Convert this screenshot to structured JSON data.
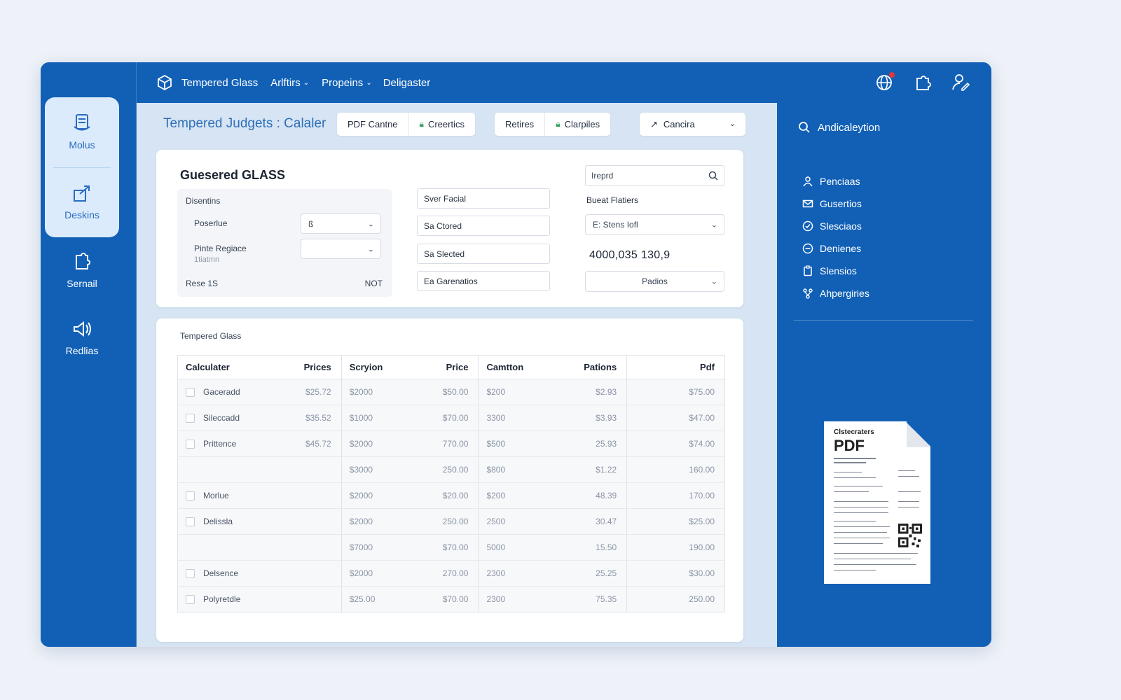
{
  "rail": {
    "items": [
      {
        "label": "Molus",
        "icon": "document-list-icon"
      },
      {
        "label": "Deskins",
        "icon": "export-icon"
      },
      {
        "label": "Sernail",
        "icon": "puzzle-icon"
      },
      {
        "label": "Redlias",
        "icon": "speaker-icon"
      }
    ]
  },
  "topbar": {
    "brand": "Tempered Glass",
    "nav": [
      {
        "label": "Arlftirs",
        "has_dropdown": true
      },
      {
        "label": "Propeins",
        "has_dropdown": true
      },
      {
        "label": "Deligaster",
        "has_dropdown": false
      }
    ],
    "icons": [
      "globe-icon",
      "puzzle-icon",
      "user-edit-icon"
    ]
  },
  "main": {
    "title": "Tempered Judgets : Calaler",
    "toolbar_left": [
      {
        "label": "PDF Cantne",
        "icon": ""
      },
      {
        "label": "Creertics",
        "icon": "lock-icon"
      }
    ],
    "toolbar_mid": [
      {
        "label": "Retires",
        "icon": ""
      },
      {
        "label": "Clarpiles",
        "icon": "lock-icon"
      }
    ],
    "toolbar_right": {
      "label": "Cancira",
      "icon": "arrow-icon"
    },
    "card": {
      "heading": "Guesered GLASS",
      "subpanel": {
        "title": "Disentins",
        "fields": [
          {
            "label": "Poserlue",
            "sub": "",
            "value": "ß"
          },
          {
            "label": "Pinte Regiace",
            "sub": "1tiatmn",
            "value": ""
          }
        ],
        "footer_left": "Rese 1S",
        "footer_right": "NOT"
      },
      "middle_fields": [
        "Sver Facial",
        "Sa Ctored",
        "Sa Slected",
        "Ea Garenatios"
      ],
      "search_placeholder": "Ireprd",
      "right_label": "Bueat Flatiers",
      "right_select": "E: Stens Iofl",
      "big_number": "4000,035 130,9",
      "bottom_select": "Padios"
    },
    "table": {
      "caption": "Tempered Glass",
      "columns": [
        "Calculater",
        "Prices",
        "Scryion",
        "Price",
        "Camtton",
        "Pations",
        "Pdf"
      ],
      "rows": [
        {
          "check": true,
          "name": "Gaceradd",
          "prices": "$25.72",
          "scryion": "$2000",
          "price": "$50.00",
          "camtton": "$200",
          "pations": "$2.93",
          "pdf": "$75.00"
        },
        {
          "check": true,
          "name": "Sileccadd",
          "prices": "$35.52",
          "scryion": "$1000",
          "price": "$70.00",
          "camtton": "3300",
          "pations": "$3.93",
          "pdf": "$47.00"
        },
        {
          "check": true,
          "name": "Prittence",
          "prices": "$45.72",
          "scryion": "$2000",
          "price": "770.00",
          "camtton": "$500",
          "pations": "25.93",
          "pdf": "$74.00"
        },
        {
          "check": false,
          "name": "",
          "prices": "",
          "scryion": "$3000",
          "price": "250.00",
          "camtton": "$800",
          "pations": "$1.22",
          "pdf": "160.00"
        },
        {
          "check": true,
          "name": "Morlue",
          "prices": "",
          "scryion": "$2000",
          "price": "$20.00",
          "camtton": "$200",
          "pations": "48.39",
          "pdf": "170.00"
        },
        {
          "check": true,
          "name": "Delissla",
          "prices": "",
          "scryion": "$2000",
          "price": "250.00",
          "camtton": "2500",
          "pations": "30.47",
          "pdf": "$25.00"
        },
        {
          "check": false,
          "name": "",
          "prices": "",
          "scryion": "$7000",
          "price": "$70.00",
          "camtton": "5000",
          "pations": "15.50",
          "pdf": "190.00"
        },
        {
          "check": true,
          "name": "Delsence",
          "prices": "",
          "scryion": "$2000",
          "price": "270.00",
          "camtton": "2300",
          "pations": "25.25",
          "pdf": "$30.00"
        },
        {
          "check": true,
          "name": "Polyretdle",
          "prices": "",
          "scryion": "$25.00",
          "price": "$70.00",
          "camtton": "2300",
          "pations": "75.35",
          "pdf": "250.00"
        }
      ]
    }
  },
  "right_panel": {
    "search_label": "Andicaleytion",
    "items": [
      {
        "label": "Penciaas",
        "icon": "user-icon"
      },
      {
        "label": "Gusertios",
        "icon": "mail-icon"
      },
      {
        "label": "Slesciaos",
        "icon": "check-circle-icon"
      },
      {
        "label": "Denienes",
        "icon": "minus-circle-icon"
      },
      {
        "label": "Slensios",
        "icon": "clipboard-icon"
      },
      {
        "label": "Ahpergiries",
        "icon": "network-icon"
      }
    ],
    "pdf_preview": {
      "caption": "Clstecraters",
      "title": "PDF"
    }
  },
  "colors": {
    "brand_blue": "#1160b6",
    "accent_blue": "#2e6fb7",
    "lock_green": "#2e9e5b",
    "badge_red": "#e53535"
  }
}
